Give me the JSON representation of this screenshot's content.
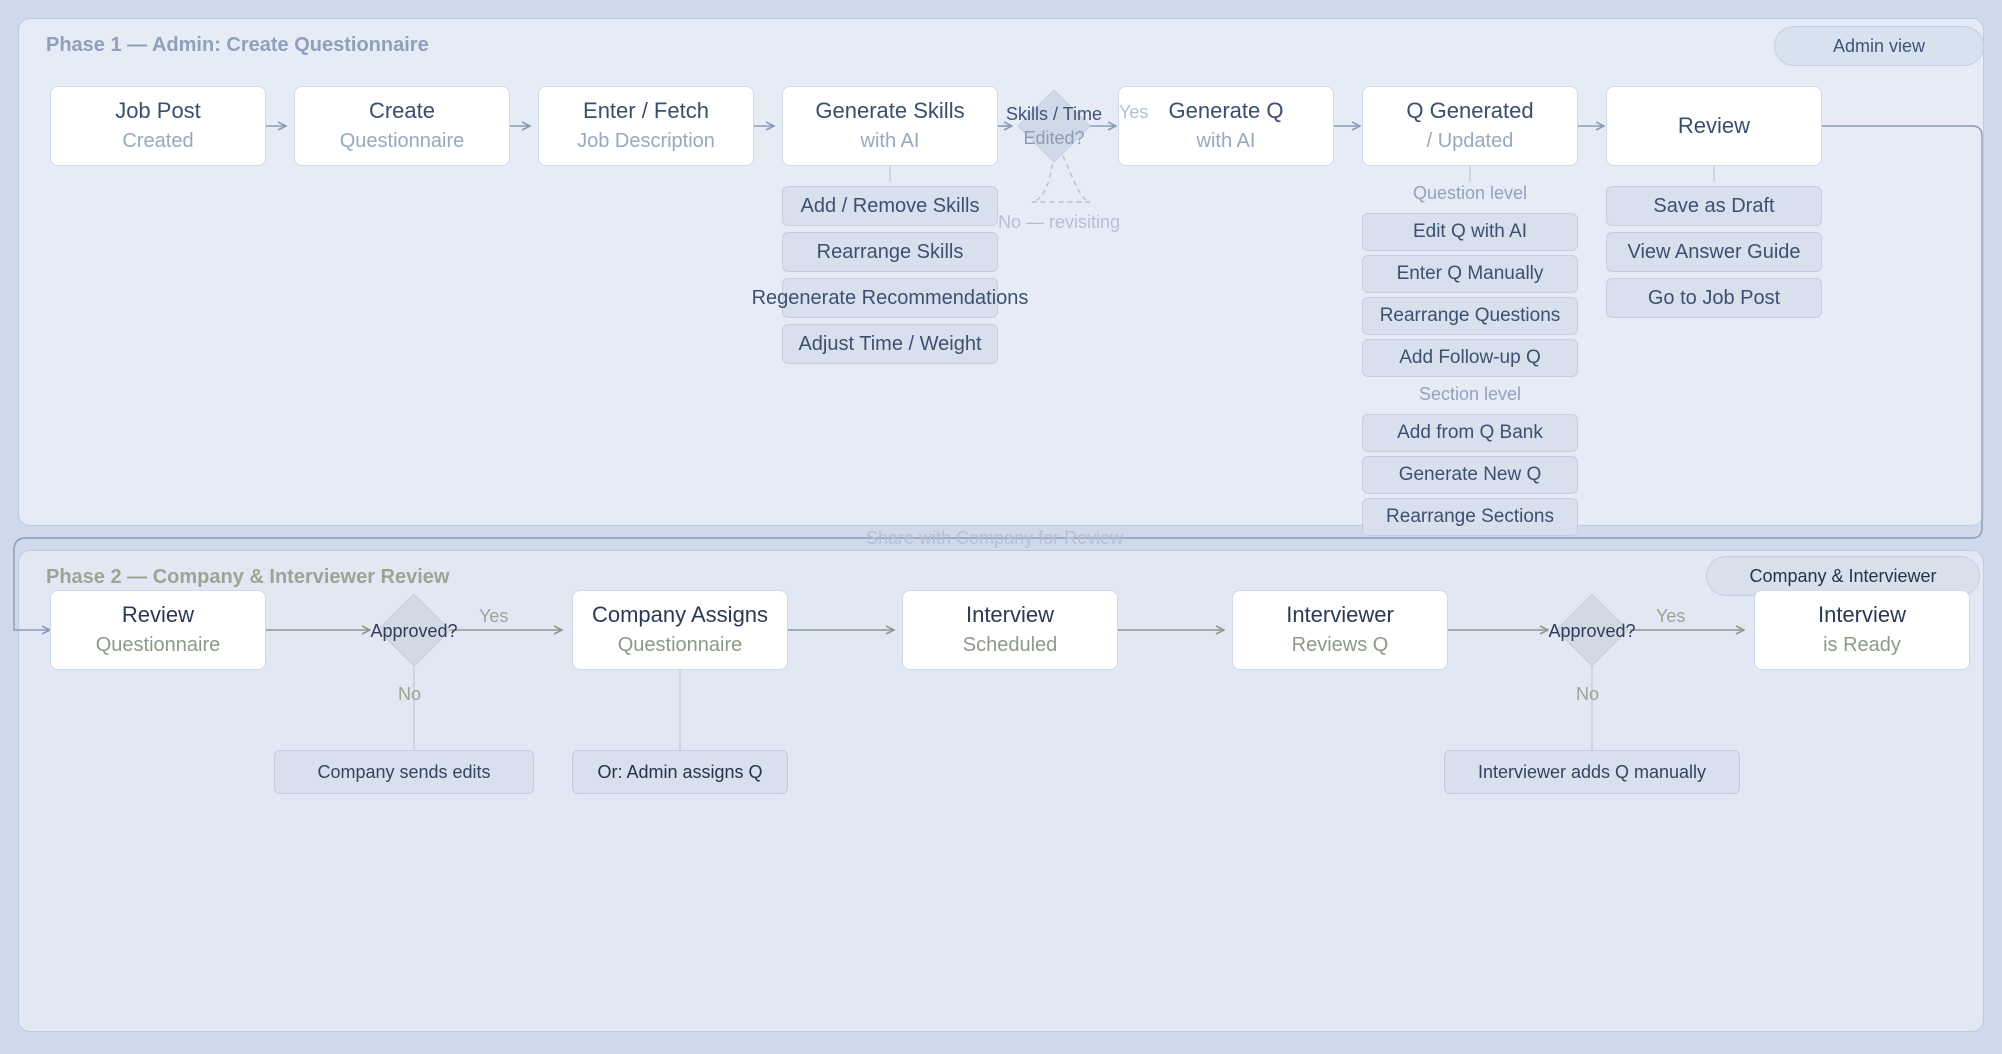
{
  "phase1": {
    "title": "Phase 1 — Admin: Create Questionnaire",
    "tag": "Admin view",
    "steps": [
      {
        "line1": "Job Post",
        "line2": "Created"
      },
      {
        "line1": "Create",
        "line2": "Questionnaire"
      },
      {
        "line1": "Enter / Fetch",
        "line2": "Job Description"
      },
      {
        "line1": "Generate Skills",
        "line2": "with AI"
      },
      {
        "line1": "Generate Q",
        "line2": "with AI"
      },
      {
        "line1": "Q Generated",
        "line2": "/ Updated"
      },
      {
        "line1": "Review"
      }
    ],
    "decision": {
      "line1": "Skills / Time",
      "line2": "Edited?",
      "yes": "Yes",
      "no": "No — revisiting"
    },
    "skill_actions": [
      "Add / Remove Skills",
      "Rearrange Skills",
      "Regenerate Recommendations",
      "Adjust Time / Weight"
    ],
    "question_level": {
      "label": "Question level",
      "items": [
        "Edit Q with AI",
        "Enter Q Manually",
        "Rearrange Questions",
        "Add Follow-up Q"
      ]
    },
    "section_level": {
      "label": "Section level",
      "items": [
        "Add from Q Bank",
        "Generate New Q",
        "Rearrange Sections"
      ]
    },
    "review_actions": [
      "Save as Draft",
      "View Answer Guide",
      "Go to Job Post"
    ]
  },
  "connector": {
    "label": "Share with Company for Review"
  },
  "phase2": {
    "title": "Phase 2 — Company & Interviewer Review",
    "tag": "Company & Interviewer",
    "steps": [
      {
        "line1": "Review",
        "line2": "Questionnaire"
      },
      {
        "line1": "Company Assigns",
        "line2": "Questionnaire"
      },
      {
        "line1": "Interview",
        "line2": "Scheduled"
      },
      {
        "line1": "Interviewer",
        "line2": "Reviews Q"
      },
      {
        "line1": "Interview",
        "line2": "is Ready"
      }
    ],
    "decision1": {
      "label": "Approved?",
      "yes": "Yes",
      "no": "No",
      "no_action": "Company sends edits"
    },
    "alt_assign": "Or: Admin assigns Q",
    "decision2": {
      "label": "Approved?",
      "yes": "Yes",
      "no": "No",
      "no_action": "Interviewer adds Q manually"
    }
  },
  "colors": {
    "background": "#cfd9ec",
    "phase1_panel": "#e6ecf6",
    "phase2_panel": "#e2e8f3",
    "phase1_arrow": "#8a9bb8",
    "phase2_arrow": "#8d9a88",
    "chip_fill": "#d8e0ed"
  }
}
